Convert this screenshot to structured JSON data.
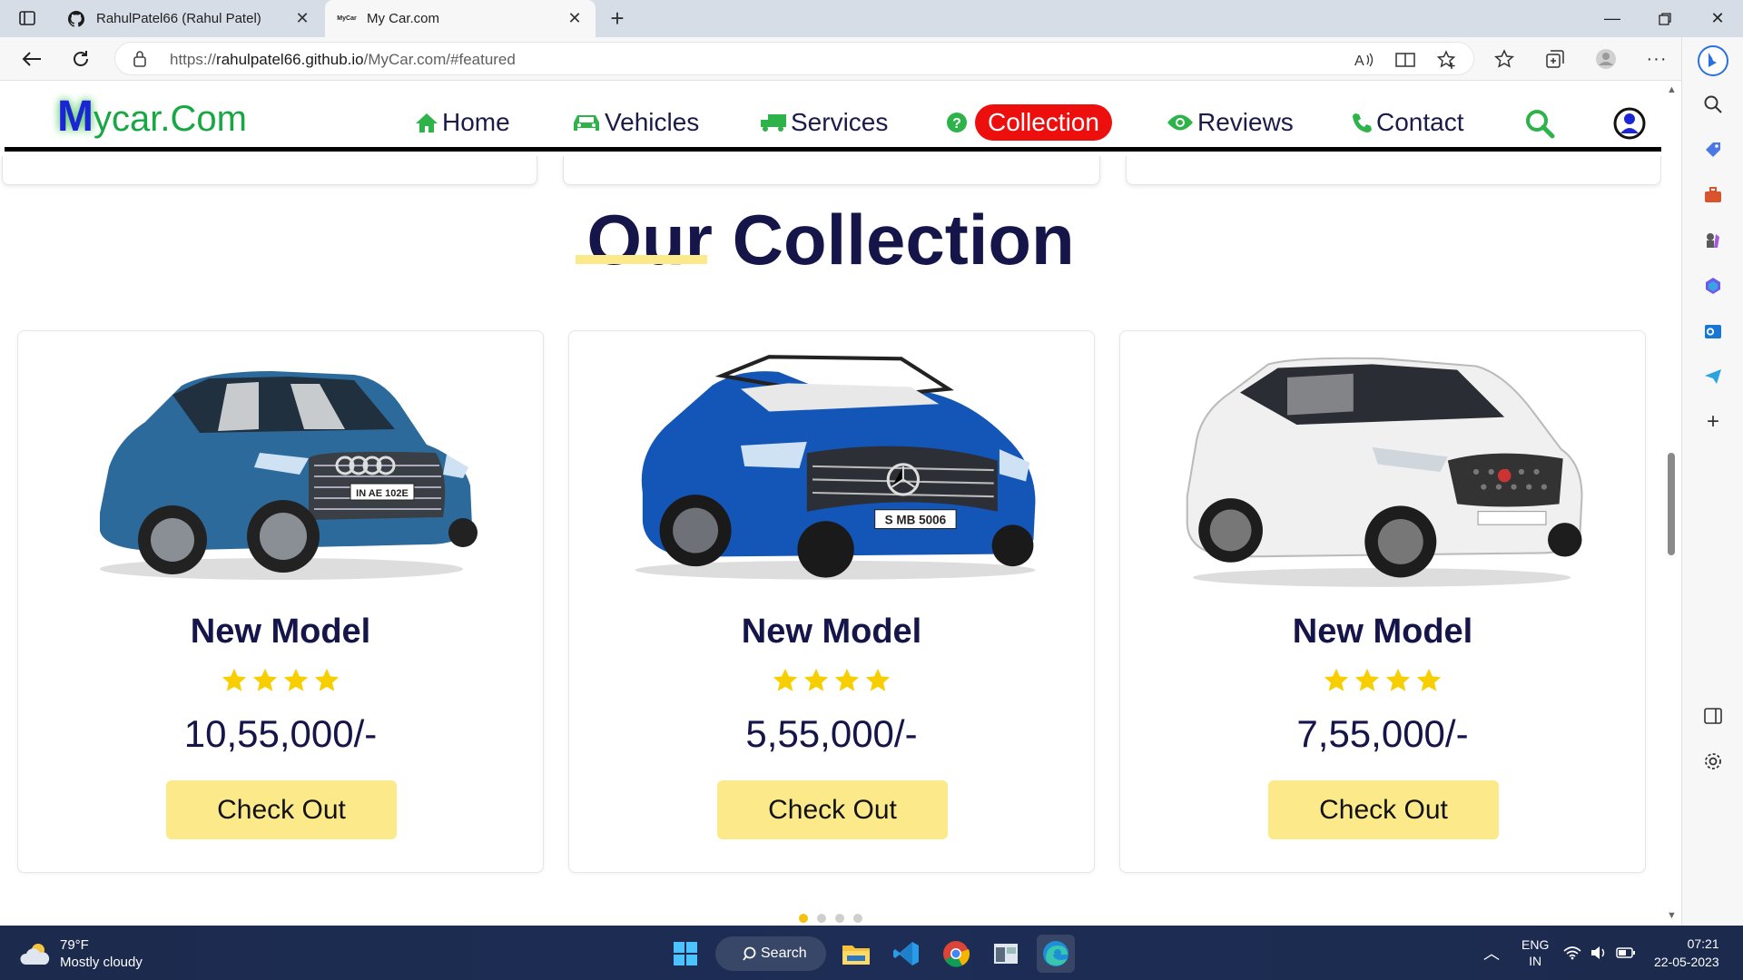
{
  "browser": {
    "tabs": [
      {
        "title": "RahulPatel66 (Rahul Patel)",
        "active": false
      },
      {
        "title": "My Car.com",
        "active": true
      }
    ],
    "url_prefix": "https://",
    "url_host": "rahulpatel66.github.io",
    "url_path": "/MyCar.com/#featured",
    "favicon_text": "MyCar"
  },
  "site": {
    "logo_m": "M",
    "logo_rest": "ycar.Com",
    "nav": [
      {
        "label": "Home",
        "icon": "home-icon"
      },
      {
        "label": "Vehicles",
        "icon": "car-icon"
      },
      {
        "label": "Services",
        "icon": "truck-icon"
      },
      {
        "label": "Collection",
        "icon": "question-icon",
        "active": true
      },
      {
        "label": "Reviews",
        "icon": "eye-icon"
      },
      {
        "label": "Contact",
        "icon": "phone-icon"
      }
    ],
    "colors": {
      "nav_icon": "#2eb34a",
      "active_pill": "#ed0e0e",
      "heading": "#15154a",
      "button": "#fbe98a",
      "star": "#f7cf00"
    }
  },
  "section": {
    "title": "Our Collection"
  },
  "cards": [
    {
      "model": "New Model",
      "rating": 4,
      "price": "10,55,000/-",
      "button": "Check Out",
      "car": "blue Audi e-tron SUV",
      "plate": "IN AE 102E"
    },
    {
      "model": "New Model",
      "rating": 4,
      "price": "5,55,000/-",
      "button": "Check Out",
      "car": "blue Mercedes SL convertible",
      "plate": "S MB 5006"
    },
    {
      "model": "New Model",
      "rating": 4,
      "price": "7,55,000/-",
      "button": "Check Out",
      "car": "white MG Gloster SUV",
      "plate": ""
    }
  ],
  "carousel": {
    "count": 4,
    "active": 1
  },
  "taskbar": {
    "temperature": "79°F",
    "condition": "Mostly cloudy",
    "search_label": "Search",
    "lang_top": "ENG",
    "lang_bottom": "IN",
    "time": "07:21",
    "date": "22-05-2023"
  }
}
